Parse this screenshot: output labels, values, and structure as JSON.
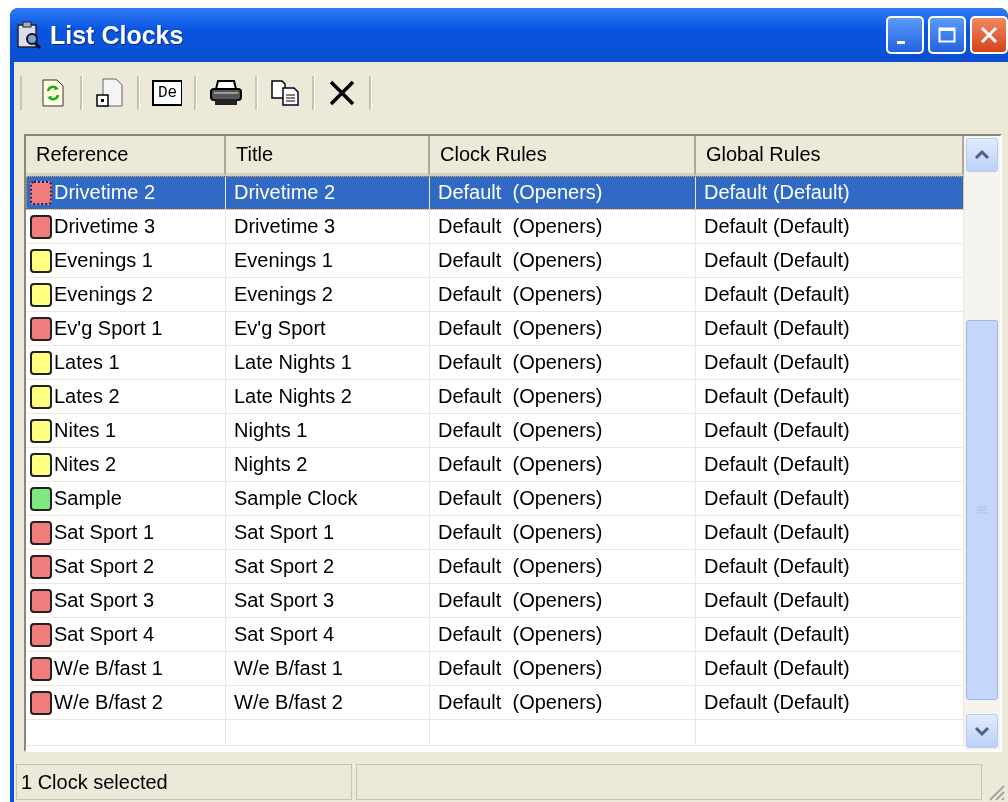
{
  "window": {
    "title": "List Clocks"
  },
  "toolbar": [
    {
      "kind": "refresh"
    },
    {
      "kind": "new"
    },
    {
      "kind": "label",
      "label": "De"
    },
    {
      "kind": "print"
    },
    {
      "kind": "copy"
    },
    {
      "kind": "delete"
    }
  ],
  "table": {
    "columns": [
      "Reference",
      "Title",
      "Clock Rules",
      "Global Rules"
    ],
    "rows": [
      {
        "reference": "Drivetime 2",
        "title": "Drivetime 2",
        "clock_rules": "Default  (Openers)",
        "global_rules": "Default (Default)",
        "color": "#f07c7c",
        "selected": true
      },
      {
        "reference": "Drivetime 3",
        "title": "Drivetime 3",
        "clock_rules": "Default  (Openers)",
        "global_rules": "Default (Default)",
        "color": "#f07c7c",
        "selected": false
      },
      {
        "reference": "Evenings 1",
        "title": "Evenings 1",
        "clock_rules": "Default  (Openers)",
        "global_rules": "Default (Default)",
        "color": "#ffff80",
        "selected": false
      },
      {
        "reference": "Evenings 2",
        "title": "Evenings 2",
        "clock_rules": "Default  (Openers)",
        "global_rules": "Default (Default)",
        "color": "#ffff80",
        "selected": false
      },
      {
        "reference": "Ev'g Sport 1",
        "title": "Ev'g Sport",
        "clock_rules": "Default  (Openers)",
        "global_rules": "Default (Default)",
        "color": "#f07c7c",
        "selected": false
      },
      {
        "reference": "Lates 1",
        "title": "Late Nights 1",
        "clock_rules": "Default  (Openers)",
        "global_rules": "Default (Default)",
        "color": "#ffff80",
        "selected": false
      },
      {
        "reference": "Lates 2",
        "title": "Late Nights 2",
        "clock_rules": "Default  (Openers)",
        "global_rules": "Default (Default)",
        "color": "#ffff80",
        "selected": false
      },
      {
        "reference": "Nites 1",
        "title": "Nights 1",
        "clock_rules": "Default  (Openers)",
        "global_rules": "Default (Default)",
        "color": "#ffff80",
        "selected": false
      },
      {
        "reference": "Nites 2",
        "title": "Nights 2",
        "clock_rules": "Default  (Openers)",
        "global_rules": "Default (Default)",
        "color": "#ffff80",
        "selected": false
      },
      {
        "reference": "Sample",
        "title": "Sample Clock",
        "clock_rules": "Default  (Openers)",
        "global_rules": "Default (Default)",
        "color": "#80e880",
        "selected": false
      },
      {
        "reference": "Sat Sport 1",
        "title": "Sat Sport 1",
        "clock_rules": "Default  (Openers)",
        "global_rules": "Default (Default)",
        "color": "#f07c7c",
        "selected": false
      },
      {
        "reference": "Sat Sport 2",
        "title": "Sat Sport 2",
        "clock_rules": "Default  (Openers)",
        "global_rules": "Default (Default)",
        "color": "#f07c7c",
        "selected": false
      },
      {
        "reference": "Sat Sport 3",
        "title": "Sat Sport 3",
        "clock_rules": "Default  (Openers)",
        "global_rules": "Default (Default)",
        "color": "#f07c7c",
        "selected": false
      },
      {
        "reference": "Sat Sport 4",
        "title": "Sat Sport 4",
        "clock_rules": "Default  (Openers)",
        "global_rules": "Default (Default)",
        "color": "#f07c7c",
        "selected": false
      },
      {
        "reference": "W/e B/fast 1",
        "title": "W/e B/fast 1",
        "clock_rules": "Default  (Openers)",
        "global_rules": "Default (Default)",
        "color": "#f07c7c",
        "selected": false
      },
      {
        "reference": "W/e B/fast 2",
        "title": "W/e B/fast 2",
        "clock_rules": "Default  (Openers)",
        "global_rules": "Default (Default)",
        "color": "#f07c7c",
        "selected": false
      }
    ]
  },
  "status_bar": {
    "text": "1 Clock selected"
  }
}
